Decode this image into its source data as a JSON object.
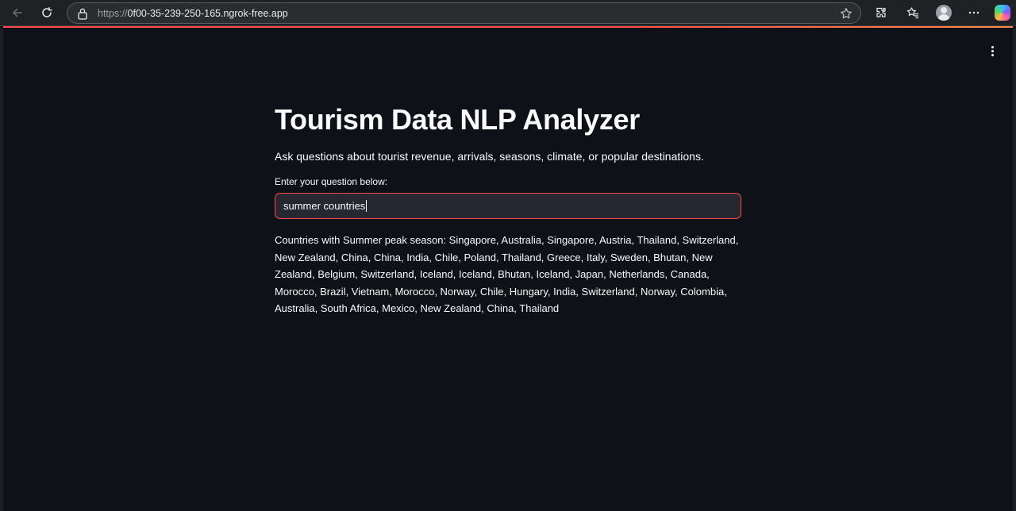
{
  "browser": {
    "url_scheme": "https://",
    "url_host": "0f00-35-239-250-165.ngrok-free.app",
    "icons": [
      "back-icon",
      "reload-icon",
      "lock-icon",
      "star-icon",
      "extensions-icon",
      "favorites-icon",
      "profile-icon",
      "more-icon",
      "copilot-icon"
    ]
  },
  "app": {
    "title": "Tourism Data NLP Analyzer",
    "subtitle": "Ask questions about tourist revenue, arrivals, seasons, climate, or popular destinations.",
    "input_label": "Enter your question below:",
    "input_value": "summer countries",
    "answer": "Countries with Summer peak season: Singapore, Australia, Singapore, Austria, Thailand, Switzerland, New Zealand, China, China, India, Chile, Poland, Thailand, Greece, Italy, Sweden, Bhutan, New Zealand, Belgium, Switzerland, Iceland, Iceland, Bhutan, Iceland, Japan, Netherlands, Canada, Morocco, Brazil, Vietnam, Morocco, Norway, Chile, Hungary, India, Switzerland, Norway, Colombia, Australia, South Africa, Mexico, New Zealand, China, Thailand"
  },
  "colors": {
    "background": "#0e1117",
    "accent": "#ff4b4b",
    "input_bg": "#262730",
    "text": "#fafafa"
  }
}
